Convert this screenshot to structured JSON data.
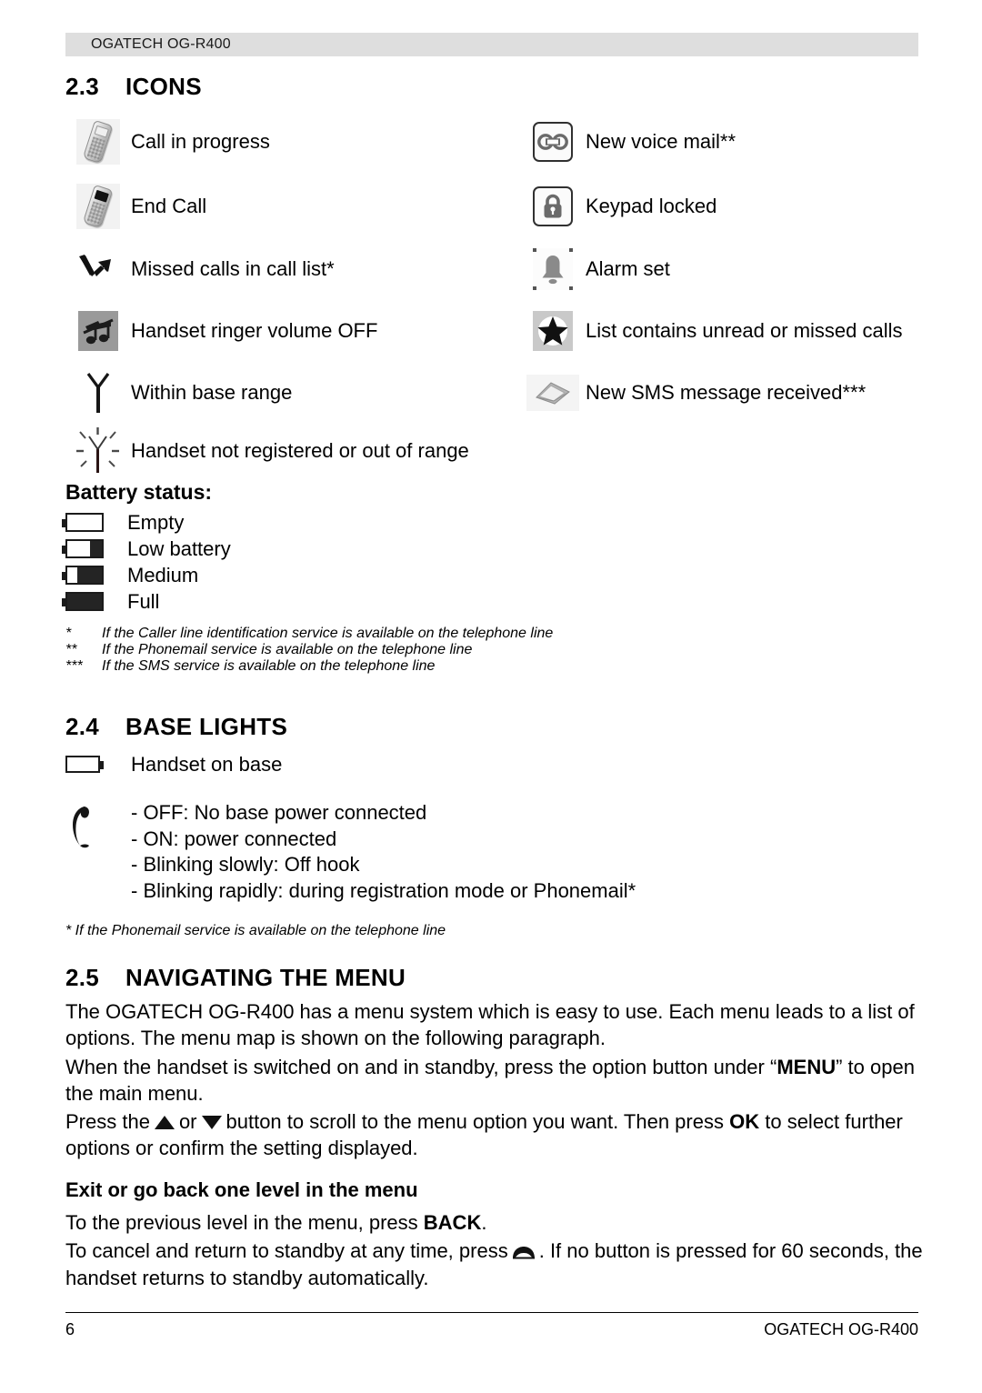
{
  "header": {
    "title": "OGATECH OG-R400"
  },
  "sections": {
    "icons": {
      "number": "2.3",
      "title": "ICONS"
    },
    "base_lights": {
      "number": "2.4",
      "title": "BASE LIGHTS"
    },
    "navigating": {
      "number": "2.5",
      "title": "NAVIGATING THE MENU"
    }
  },
  "icon_table": {
    "rows": [
      {
        "left_icon": "handset-call-in-progress-icon",
        "left_label": "Call in progress",
        "right_icon": "voicemail-icon",
        "right_label": "New voice mail**"
      },
      {
        "left_icon": "handset-end-call-icon",
        "left_label": "End Call",
        "right_icon": "keypad-lock-icon",
        "right_label": "Keypad locked"
      },
      {
        "left_icon": "missed-call-arrow-icon",
        "left_label": "Missed calls in call list*",
        "right_icon": "alarm-bell-icon",
        "right_label": "Alarm set"
      },
      {
        "left_icon": "ringer-volume-off-icon",
        "left_label": "Handset ringer volume OFF",
        "right_icon": "star-unread-icon",
        "right_label": "List contains unread or missed calls"
      },
      {
        "left_icon": "antenna-in-range-icon",
        "left_label": "Within base range",
        "right_icon": "sms-envelope-icon",
        "right_label": "New SMS message received***"
      },
      {
        "left_icon": "antenna-out-of-range-icon",
        "left_label": "Handset not registered or out of range",
        "right_icon": "",
        "right_label": ""
      }
    ]
  },
  "battery": {
    "heading": "Battery status:",
    "levels": [
      {
        "icon": "battery-empty-icon",
        "fill_percent": 0,
        "label": "Empty"
      },
      {
        "icon": "battery-low-icon",
        "fill_percent": 33,
        "label": "Low battery"
      },
      {
        "icon": "battery-medium-icon",
        "fill_percent": 72,
        "label": "Medium"
      },
      {
        "icon": "battery-full-icon",
        "fill_percent": 100,
        "label": "Full"
      }
    ]
  },
  "footnotes": [
    {
      "mark": "*",
      "text": "If the Caller line identification service is available on the telephone line"
    },
    {
      "mark": "**",
      "text": "If the Phonemail service is available on the telephone line"
    },
    {
      "mark": "***",
      "text": "If the SMS service is available on the telephone line"
    }
  ],
  "base_lights": {
    "handset_on_base": {
      "icon": "handset-on-base-battery-icon",
      "label": "Handset on base"
    },
    "handset_icon": "base-handset-light-icon",
    "states": [
      "- OFF: No base power connected",
      "- ON: power connected",
      "- Blinking slowly: Off hook",
      "- Blinking rapidly: during registration mode or Phonemail*"
    ],
    "note": "* If the Phonemail service is available on the telephone line"
  },
  "navigating": {
    "para1": "The OGATECH OG-R400 has a menu system which is easy to use. Each menu leads to a list of options. The menu map is shown on the following paragraph.",
    "para2_a": "When the handset is switched on and in standby, press the option button under “",
    "para2_bold": "MENU",
    "para2_b": "” to open the main menu.",
    "para3_a": "Press the",
    "para3_or": "or",
    "para3_b": "button to scroll to the menu option you want. Then press",
    "para3_bold": "OK",
    "para3_c": "to select further options or confirm the setting displayed.",
    "exit_heading": "Exit or go back one level in the menu",
    "exit_a": "To the previous level in the menu, press",
    "exit_bold": "BACK",
    "exit_a_end": ".",
    "exit_b": "To cancel and return to standby at any time, press",
    "exit_b_end": ". If no button is pressed for 60 seconds, the handset returns to standby automatically.",
    "end_call_glyph_name": "end-call-key-icon"
  },
  "footer": {
    "page_number": "6",
    "product": "OGATECH OG-R400"
  },
  "colors": {
    "header_band": "#dedede",
    "ink": "#000000",
    "icon_grey": "#9a9a9a",
    "battery_fill": "#242424"
  }
}
